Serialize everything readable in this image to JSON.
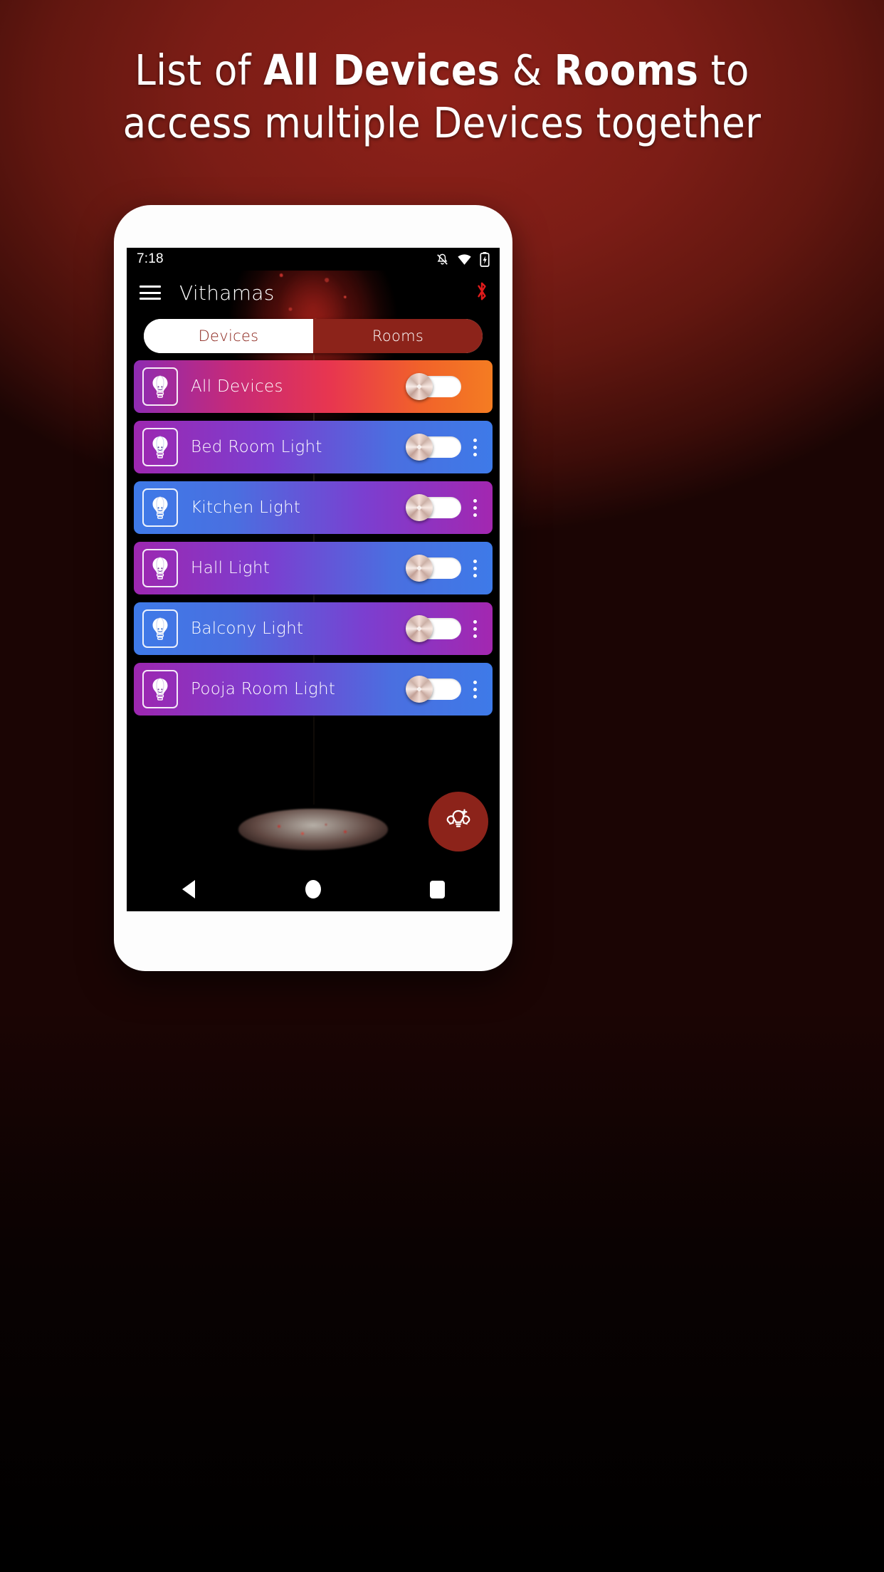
{
  "promo": {
    "line1_prefix": "List of ",
    "line1_bold1": "All Devices",
    "line1_mid": " & ",
    "line1_bold2": "Rooms",
    "line1_suffix": " to",
    "line2": "access multiple Devices together"
  },
  "statusbar": {
    "time": "7:18",
    "icons": [
      "bell-muted-icon",
      "wifi-icon",
      "battery-charging-icon"
    ]
  },
  "appbar": {
    "menu_icon": "hamburger-menu-icon",
    "title": "Vithamas",
    "action_icon": "bluetooth-icon",
    "bluetooth_color": "#e01b1b"
  },
  "tabs": {
    "items": [
      {
        "label": "Devices",
        "active": false
      },
      {
        "label": "Rooms",
        "active": true
      }
    ],
    "active_bg": "#8c231a",
    "inactive_text": "#8a2219"
  },
  "list": {
    "rows": [
      {
        "label": "All Devices",
        "icon": "bulb-icon",
        "toggle": "off",
        "has_menu": false,
        "gradient": "purple-pink-orange"
      },
      {
        "label": "Bed Room Light",
        "icon": "bulb-icon",
        "toggle": "off",
        "has_menu": true,
        "gradient": "purple-blue"
      },
      {
        "label": "Kitchen Light",
        "icon": "bulb-icon",
        "toggle": "off",
        "has_menu": true,
        "gradient": "blue-purple"
      },
      {
        "label": "Hall Light",
        "icon": "bulb-icon",
        "toggle": "off",
        "has_menu": true,
        "gradient": "purple-blue"
      },
      {
        "label": "Balcony Light",
        "icon": "bulb-icon",
        "toggle": "off",
        "has_menu": true,
        "gradient": "blue-purple"
      },
      {
        "label": "Pooja Room Light",
        "icon": "bulb-icon",
        "toggle": "off",
        "has_menu": true,
        "gradient": "purple-blue"
      }
    ]
  },
  "fab": {
    "icon": "add-bulbs-icon",
    "color": "#8c231a"
  },
  "navbar": {
    "items": [
      {
        "icon": "back-triangle-icon"
      },
      {
        "icon": "home-circle-icon"
      },
      {
        "icon": "recents-square-icon"
      }
    ]
  }
}
